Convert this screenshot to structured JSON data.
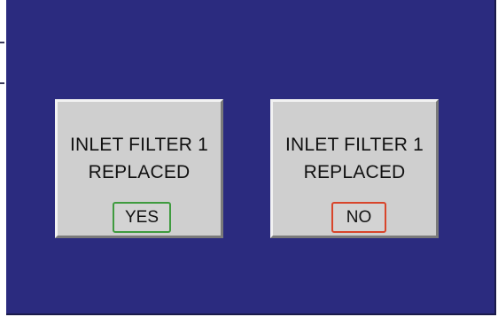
{
  "buttons": [
    {
      "line1": "INLET FILTER 1",
      "line2": "REPLACED",
      "choice": "YES",
      "choice_color": "#3f9b3f"
    },
    {
      "line1": "INLET FILTER 1",
      "line2": "REPLACED",
      "choice": "NO",
      "choice_color": "#d8452b"
    }
  ],
  "colors": {
    "screen_background": "#2b2b7f",
    "button_face": "#cfcfcf"
  }
}
